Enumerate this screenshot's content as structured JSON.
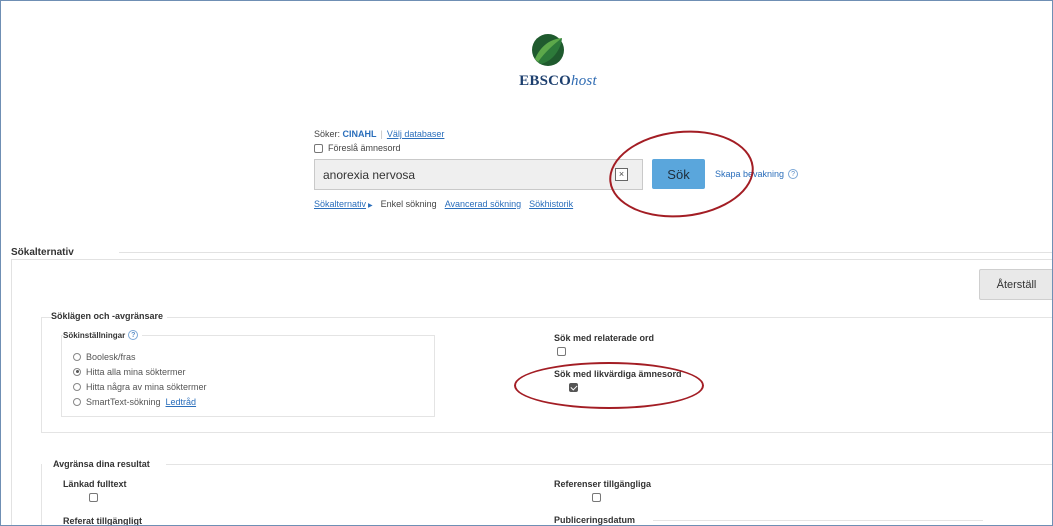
{
  "logo": {
    "brand": "EBSCO",
    "suffix": "host"
  },
  "search": {
    "searching_label": "Söker:",
    "database": "CINAHL",
    "choose_db": "Välj databaser",
    "suggest_label": "Föreslå ämnesord",
    "query": "anorexia nervosa",
    "clear_symbol": "×",
    "submit_label": "Sök",
    "create_alert": "Skapa bevakning",
    "help_symbol": "?"
  },
  "subnav": {
    "options": "Sökalternativ",
    "simple": "Enkel sökning",
    "advanced": "Avancerad sökning",
    "history": "Sökhistorik"
  },
  "options": {
    "title": "Sökalternativ",
    "reset_label": "Återställ",
    "modes_title": "Söklägen och -avgränsare",
    "settings_title": "Sökinställningar",
    "radios": [
      {
        "label": "Boolesk/fras",
        "selected": false
      },
      {
        "label": "Hitta alla mina söktermer",
        "selected": true
      },
      {
        "label": "Hitta några av mina söktermer",
        "selected": false
      },
      {
        "label": "SmartText-sökning",
        "selected": false
      }
    ],
    "hint_link": "Ledtråd",
    "related_words": "Sök med relaterade ord",
    "equivalent_subjects": "Sök med likvärdiga ämnesord"
  },
  "limits": {
    "title": "Avgränsa dina resultat",
    "linked_fulltext": "Länkad fulltext",
    "references_available": "Referenser tillgängliga",
    "abstract_available": "Referat tillgängligt",
    "publication_date": "Publiceringsdatum"
  },
  "colors": {
    "accent": "#5aa6dc",
    "link": "#2a6ebb",
    "annotation": "#a31d24"
  }
}
